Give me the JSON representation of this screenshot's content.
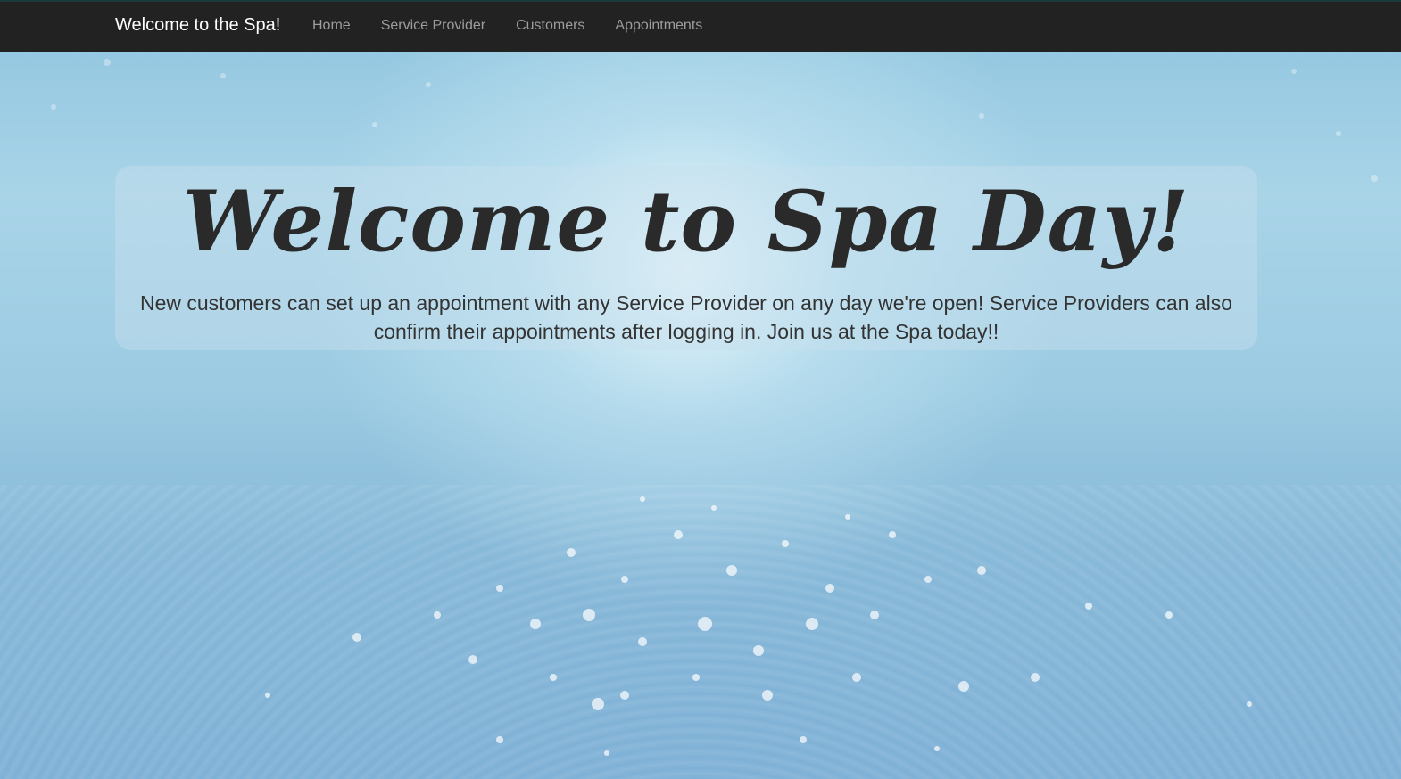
{
  "navbar": {
    "brand": "Welcome to the Spa!",
    "links": [
      {
        "label": "Home"
      },
      {
        "label": "Service Provider"
      },
      {
        "label": "Customers"
      },
      {
        "label": "Appointments"
      }
    ]
  },
  "hero": {
    "title": "Welcome to Spa Day!",
    "text": "New customers can set up an appointment with any Service Provider on any day we're open! Service Providers can also confirm their appointments after logging in. Join us at the Spa today!!"
  },
  "colors": {
    "navbar_bg": "#222222",
    "brand_text": "#ffffff",
    "nav_link": "#9d9d9d",
    "hero_text": "#333333"
  }
}
